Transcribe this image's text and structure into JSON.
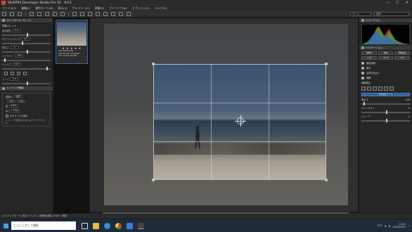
{
  "window": {
    "title": "SILKYPIX Developer Studio Pro 10　#1/1",
    "controls": [
      "—",
      "☐",
      "✕"
    ]
  },
  "menu": [
    "ファイル(F)",
    "編集(E)",
    "操作モード(M)",
    "表示(V)",
    "ギャラリー(G)",
    "現像(D)",
    "ウインドウ(W)",
    "オプション(O)",
    "ヘルプ(H)"
  ],
  "toolbar": {
    "search_placeholder": "名前",
    "zoom_label": "ズーム"
  },
  "left_panel": {
    "header": "コントロール パレット",
    "sections": [
      {
        "title": "現像パレット"
      },
      {
        "title": "露出補正",
        "value": "0.0"
      },
      {
        "title": "ホワイトバランス",
        "value": "1/3"
      },
      {
        "title": "明るさ",
        "value": "0"
      },
      {
        "title": "ハイライト",
        "value": "-100"
      },
      {
        "title": "シャドウ",
        "value": "100"
      },
      {
        "title": "トーン",
        "value": "0.0"
      }
    ],
    "trim": {
      "title": "トリミング情報",
      "aspect_label": "縦横比",
      "width_label": "幅",
      "height_label": "高さ",
      "x_value": "704",
      "y_value": "704",
      "w_value": "4356",
      "h_value": "3195",
      "ratio_label": "任意",
      "checkbox_label": "元のサイズに固定",
      "note": "トリミング範囲の拡大縮小はマウスで行えます。"
    }
  },
  "thumbnail": {
    "stars": "★ ★ ★ ★ ★",
    "filename": "P1010465.RW2",
    "date": "2023/02/10 14:46:08",
    "exif": "F10 1/1250 ISO200"
  },
  "right_panel": {
    "histogram_label": "ヒストグラム",
    "nav_label": "ナビゲーション",
    "buttons": [
      "初期化",
      "自動",
      "現像設定"
    ],
    "ev_values": [
      "-2.33",
      "+0.00",
      "0.00"
    ],
    "items": [
      "撮影画面",
      "露光",
      "自然な色合い",
      "明瞭"
    ],
    "tone_label": "明暗補正",
    "active_tool": "部分補正ツール",
    "sliders": [
      {
        "label": "明るさ",
        "value": "-100"
      },
      {
        "label": "コントラスト",
        "value": "0"
      },
      {
        "label": "シャープ",
        "value": "0"
      }
    ]
  },
  "status": {
    "text": "[トリミングモード] 角をドラッグして範囲を調整 / Enter で確定"
  },
  "taskbar": {
    "search_placeholder": "ここに入力して検索",
    "weather": "19°C",
    "time": "15:00",
    "date": "2023/03/15",
    "ime": "あ"
  }
}
